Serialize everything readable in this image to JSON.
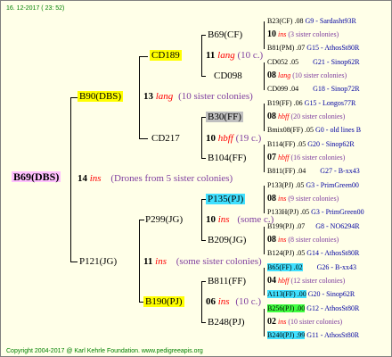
{
  "header": {
    "date": "16. 12-2017 ( 23: 52)"
  },
  "footer": {
    "copyright": "Copyright 2004-2017 @ Karl Kehrle Foundation.   www.pedigreeapis.org"
  },
  "root": {
    "name": "B69(DBS)",
    "num": "14",
    "code": "ins",
    "note": "(Drones from 5 sister colonies)"
  },
  "mother": {
    "name": "B90(DBS)",
    "num": "13",
    "code": "lang",
    "note": "(10 sister colonies)"
  },
  "father": {
    "name": "P121(JG)",
    "num": "11",
    "code": "ins",
    "note": "(some sister colonies)"
  },
  "cd189": {
    "name": "CD189",
    "num": "11",
    "code": "lang",
    "note": "(10 c.)"
  },
  "cd217": {
    "name": "CD217",
    "num": "10",
    "code": "hbff",
    "note": "(19 c.)"
  },
  "p299": {
    "name": "P299(JG)",
    "num": "10",
    "code": "ins",
    "note": "(some c.)"
  },
  "b190": {
    "name": "B190(PJ)",
    "num": "06",
    "code": "ins",
    "note": "(10 c.)"
  },
  "g3": {
    "b69cf": "B69(CF)",
    "cd098": "CD098",
    "b30ff": "B30(FF)",
    "b104ff": "B104(FF)",
    "p135pj": "P135(PJ)",
    "b209jg": "B209(JG)",
    "b811ff": "B811(FF)",
    "b248pj": "B248(PJ)"
  },
  "r": [
    {
      "a": "B23(CF) .08",
      "b": "G9 - Sardasht93R"
    },
    {
      "num": "10",
      "code": "ins",
      "note": "(3 sister colonies)"
    },
    {
      "a": "B81(PM) .07",
      "b": "G15 - AthosSt80R"
    },
    {
      "a": "CD052 .05",
      "b": "G21 - Sinop62R"
    },
    {
      "num": "08",
      "code": "lang",
      "note": "(10 sister colonies)"
    },
    {
      "a": "CD099 .04",
      "b": "G18 - Sinop72R"
    },
    {
      "a": "B19(FF) .06",
      "b": "G15 - Longos77R"
    },
    {
      "num": "08",
      "code": "hbff",
      "note": "(20 sister colonies)"
    },
    {
      "a": "Bmix08(FF) .05",
      "b": "G0 - old lines B"
    },
    {
      "a": "B114(FF) .05",
      "b": "G20 - Sinop62R"
    },
    {
      "num": "07",
      "code": "hbff",
      "note": "(16 sister colonies)"
    },
    {
      "a": "B811(FF) .04",
      "b": "G27 - B-xx43"
    },
    {
      "a": "P133(PJ) .05",
      "b": "G3 - PrimGreen00"
    },
    {
      "num": "08",
      "code": "ins",
      "note": "(9 sister colonies)"
    },
    {
      "a": "P133H(PJ) .05",
      "b": "G3 - PrimGreen00"
    },
    {
      "a": "B199(PJ) .07",
      "b": "G8 - NO6294R"
    },
    {
      "num": "08",
      "code": "ins",
      "note": "(8 sister colonies)"
    },
    {
      "a": "B124(PJ) .05",
      "b": "G14 - AthosSt80R"
    },
    {
      "a": "B65(FF) .02",
      "b": "G26 - B-xx43"
    },
    {
      "num": "04",
      "code": "hbff",
      "note": "(12 sister colonies)"
    },
    {
      "a": "A113(FF) .00",
      "b": "G20 - Sinop62R"
    },
    {
      "a": "B256(PJ) .00",
      "b": "G12 - AthosSt80R"
    },
    {
      "num": "02",
      "code": "ins",
      "note": "(10 sister colonies)"
    },
    {
      "a": "B240(PJ) .99",
      "b": "G11 - AthosSt80R"
    }
  ]
}
